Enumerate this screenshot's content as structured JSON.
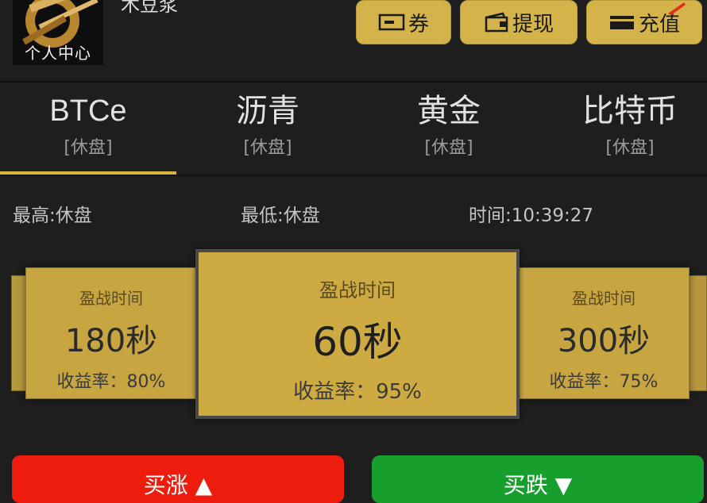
{
  "user": {
    "avatar_label": "个人中心",
    "name": "木豆浆"
  },
  "actions": {
    "coupon_label": "券",
    "withdraw_label": "提现",
    "recharge_label": "充值"
  },
  "products": [
    {
      "name": "BTCe",
      "status": "[休盘]"
    },
    {
      "name": "沥青",
      "status": "[休盘]"
    },
    {
      "name": "黄金",
      "status": "[休盘]"
    },
    {
      "name": "比特币",
      "status": "[休盘]"
    }
  ],
  "stats": {
    "high": "最高:休盘",
    "low": "最低:休盘",
    "time": "时间:10:39:27"
  },
  "cards": [
    {
      "label": "盈战时间",
      "duration": "180秒",
      "rate": "收益率：80%"
    },
    {
      "label": "盈战时间",
      "duration": "60秒",
      "rate": "收益率：95%"
    },
    {
      "label": "盈战时间",
      "duration": "300秒",
      "rate": "收益率：75%"
    }
  ],
  "buttons": {
    "up_label": "买涨 ▲",
    "down_label": "买跌 ▼"
  },
  "colors": {
    "background": "#1e1e1e",
    "accent_gold": "#d3b34a",
    "buy_up": "#ee1c0c",
    "buy_down": "#169f2c"
  }
}
